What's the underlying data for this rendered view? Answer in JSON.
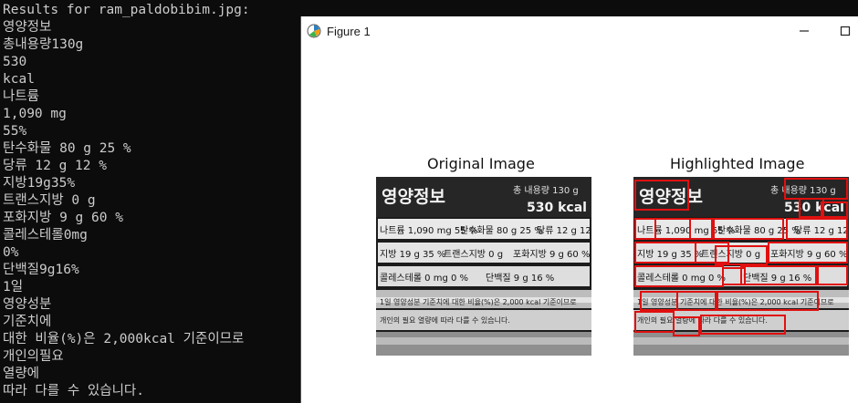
{
  "terminal": {
    "lines": [
      "Results for ram_paldobibim.jpg:",
      "영양정보",
      "총내용량130g",
      "530",
      "kcal",
      "나트륨",
      "1,090 mg",
      "55%",
      "탄수화물 80 g 25 %",
      "당류 12 g 12 %",
      "지방19g35%",
      "트랜스지방 0 g",
      "포화지방 9 g 60 %",
      "콜레스테롤0mg",
      "0%",
      "단백질9g16%",
      "1일",
      "영양성분",
      "기준치에",
      "대한 비율(%)은 2,000kcal 기준이므로",
      "개인의필요",
      "열량에",
      "따라 다를 수 있습니다."
    ]
  },
  "figure": {
    "title": "Figure 1",
    "icon": "matplotlib-icon",
    "minimize_icon": "minimize-icon",
    "maximize_icon": "maximize-icon",
    "subplots": [
      {
        "title": "Original Image"
      },
      {
        "title": "Highlighted Image"
      }
    ]
  },
  "label_text": {
    "header_left": "영양정보",
    "header_right_top": "총 내용량 130 g",
    "header_right_bottom": "530 kcal",
    "row1_a": "나트륨 1,090 mg 55 %",
    "row1_b": "탄수화물 80 g 25 %",
    "row1_c": "당류 12 g 12 %",
    "row2_a": "지방 19 g 35 %",
    "row2_b": "트랜스지방 0 g",
    "row2_c": "포화지방 9 g 60 %",
    "row3_a": "콜레스테롤 0 mg 0 %",
    "row3_b": "단백질 9 g 16 %",
    "foot1": "1일 영양성분 기준치에 대한 비율(%)은 2,000 kcal 기준이므로",
    "foot2": "개인의 필요 열량에 따라 다를 수 있습니다."
  },
  "colors": {
    "terminal_bg": "#0c0c0c",
    "terminal_text": "#cccccc",
    "highlight_box": "#e01010"
  }
}
